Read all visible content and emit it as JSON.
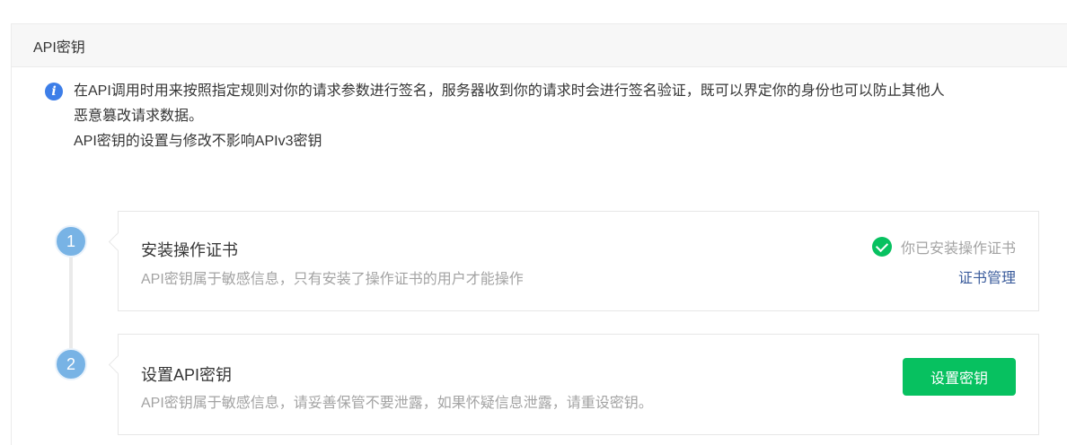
{
  "panel": {
    "title": "API密钥"
  },
  "notice": {
    "icon": "info-icon",
    "lines": [
      "在API调用时用来按照指定规则对你的请求参数进行签名，服务器收到你的请求时会进行签名验证，既可以界定你的身份也可以防止其他人",
      "恶意篡改请求数据。",
      "API密钥的设置与修改不影响APIv3密钥"
    ]
  },
  "steps": [
    {
      "number": "1",
      "title": "安装操作证书",
      "desc": "API密钥属于敏感信息，只有安装了操作证书的用户才能操作",
      "status_text": "你已安装操作证书",
      "status_icon": "check-circle-icon",
      "link": "证书管理"
    },
    {
      "number": "2",
      "title": "设置API密钥",
      "desc": "API密钥属于敏感信息，请妥善保管不要泄露，如果怀疑信息泄露，请重设密钥。",
      "button": "设置密钥"
    }
  ],
  "colors": {
    "accent_green": "#07c160",
    "link_blue": "#3b5c9c",
    "step_blue": "#78b3e5",
    "info_blue": "#3d7ee8"
  }
}
